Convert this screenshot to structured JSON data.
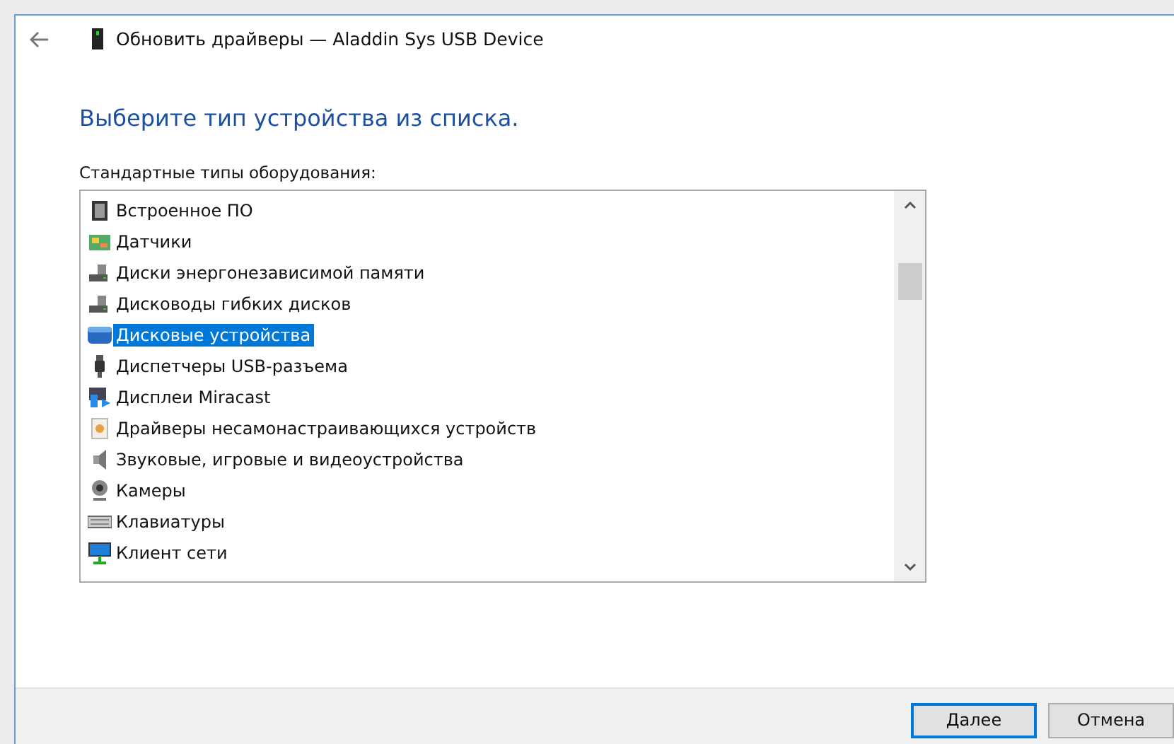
{
  "window": {
    "title": "Обновить драйверы — Aladdin Sys USB Device"
  },
  "heading": "Выберите тип устройства из списка.",
  "list_label": "Стандартные типы оборудования:",
  "items": [
    {
      "label": "Встроенное ПО",
      "selected": false
    },
    {
      "label": "Датчики",
      "selected": false
    },
    {
      "label": "Диски энергонезависимой памяти",
      "selected": false
    },
    {
      "label": "Дисководы гибких дисков",
      "selected": false
    },
    {
      "label": "Дисковые устройства",
      "selected": true
    },
    {
      "label": "Диспетчеры USB-разъема",
      "selected": false
    },
    {
      "label": "Дисплеи Miracast",
      "selected": false
    },
    {
      "label": "Драйверы несамонастраивающихся устройств",
      "selected": false
    },
    {
      "label": "Звуковые, игровые и видеоустройства",
      "selected": false
    },
    {
      "label": "Камеры",
      "selected": false
    },
    {
      "label": "Клавиатуры",
      "selected": false
    },
    {
      "label": "Клиент сети",
      "selected": false
    }
  ],
  "buttons": [
    {
      "label": "Далее",
      "kind": "default"
    },
    {
      "label": "Отмена",
      "kind": "normal"
    }
  ]
}
